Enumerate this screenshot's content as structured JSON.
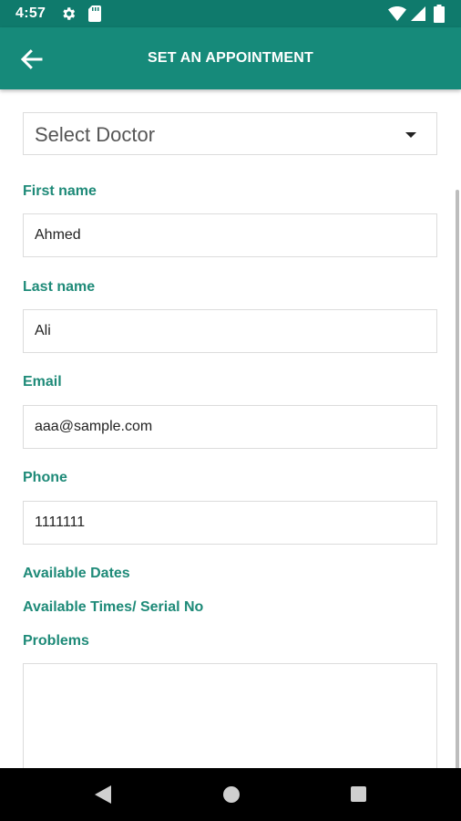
{
  "status_bar": {
    "time": "4:57",
    "icons": [
      "gear-icon",
      "sd-card-icon",
      "wifi-icon",
      "signal-icon",
      "battery-icon"
    ]
  },
  "app_bar": {
    "title": "SET AN APPOINTMENT",
    "back_icon": "arrow-left-icon",
    "color": "#168a7a"
  },
  "form": {
    "doctor_select": {
      "selected": "Select Doctor"
    },
    "first_name": {
      "label": "First name",
      "value": "Ahmed"
    },
    "last_name": {
      "label": "Last name",
      "value": "Ali"
    },
    "email": {
      "label": "Email",
      "value": "aaa@sample.com"
    },
    "phone": {
      "label": "Phone",
      "value": "1111111"
    },
    "available_dates_label": "Available Dates",
    "available_times_label": "Available Times/ Serial No",
    "problems": {
      "label": "Problems",
      "value": ""
    }
  },
  "nav_bar": {
    "icons": [
      "nav-back-icon",
      "nav-home-icon",
      "nav-recents-icon"
    ]
  },
  "colors": {
    "status_bar": "#0f7a6c",
    "accent": "#1e8a78"
  }
}
